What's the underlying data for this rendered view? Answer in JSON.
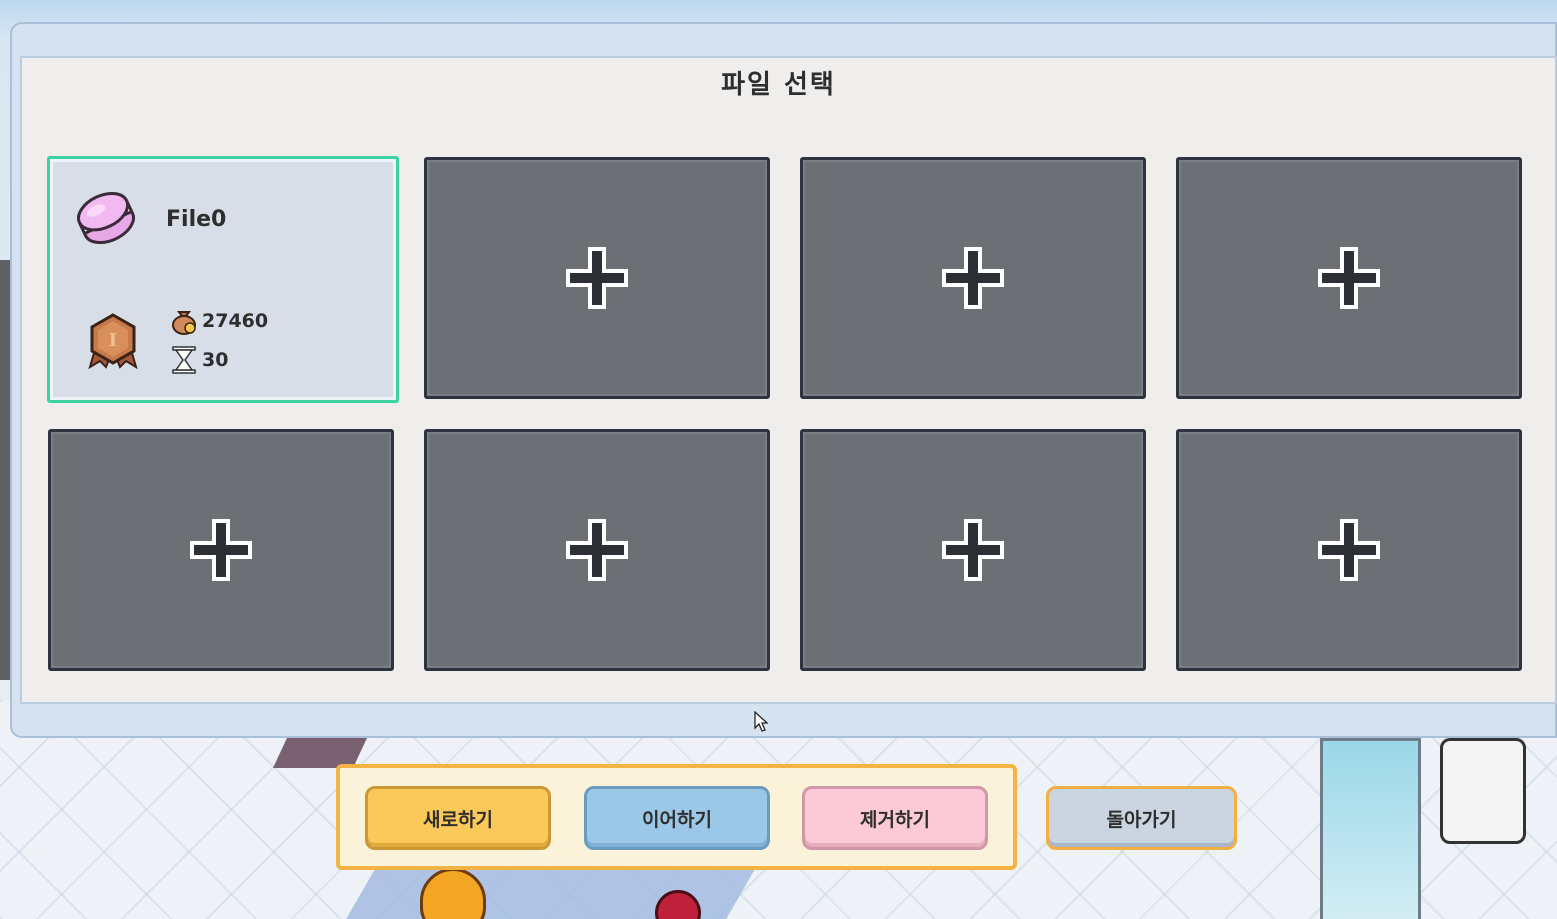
{
  "dialog": {
    "title": "파일 선택"
  },
  "slots": [
    {
      "state": "filled",
      "name": "File0",
      "money": "27460",
      "time": "30",
      "rank_icon": "bronze-rank-badge-icon",
      "avatar_icon": "pink-macaron-icon"
    },
    {
      "state": "empty",
      "icon": "plus-icon"
    },
    {
      "state": "empty",
      "icon": "plus-icon"
    },
    {
      "state": "empty",
      "icon": "plus-icon"
    },
    {
      "state": "empty",
      "icon": "plus-icon"
    },
    {
      "state": "empty",
      "icon": "plus-icon"
    },
    {
      "state": "empty",
      "icon": "plus-icon"
    },
    {
      "state": "empty",
      "icon": "plus-icon"
    }
  ],
  "buttons": {
    "new": "새로하기",
    "continue": "이어하기",
    "delete": "제거하기",
    "back": "돌아가기"
  },
  "colors": {
    "selected_border": "#3ad3a1",
    "empty_slot": "#6c6f74",
    "btn_new": "#fbc85a",
    "btn_continue": "#9cc8e8",
    "btn_delete": "#fccad6",
    "btn_back": "#cbd4e1"
  }
}
